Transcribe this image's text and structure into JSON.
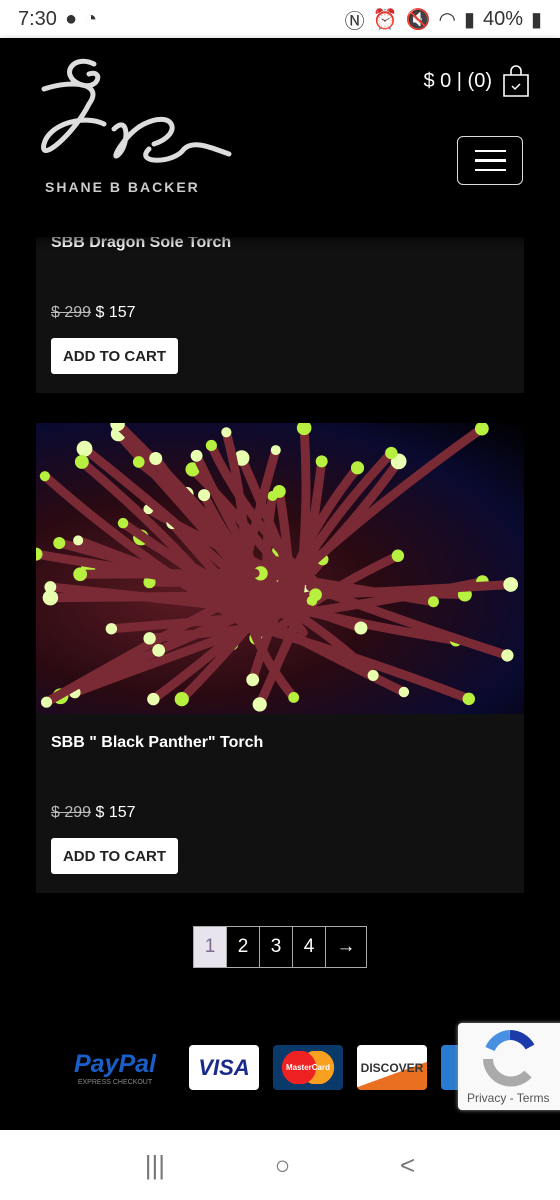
{
  "status": {
    "time": "7:30",
    "battery": "40%"
  },
  "header": {
    "brand": "SHANE B BACKER",
    "cart_text": "$ 0 | (0)"
  },
  "products": [
    {
      "title": "SBB Dragon Sole Torch",
      "old_price": "$ 299",
      "price": "$ 157",
      "button": "ADD TO CART"
    },
    {
      "title": "SBB \" Black Panther\" Torch",
      "old_price": "$ 299",
      "price": "$ 157",
      "button": "ADD TO CART"
    }
  ],
  "pagination": {
    "pages": [
      "1",
      "2",
      "3",
      "4"
    ],
    "next": "→",
    "current": "1"
  },
  "payments": {
    "paypal": "PayPal",
    "paypal_sub": "EXPRESS CHECKOUT",
    "visa": "VISA",
    "mastercard": "MasterCard",
    "discover": "DISCOVER",
    "amex": "AMEX"
  },
  "recaptcha": {
    "links": "Privacy - Terms"
  },
  "navbar": {
    "recent": "|||",
    "home": "○",
    "back": "<"
  }
}
